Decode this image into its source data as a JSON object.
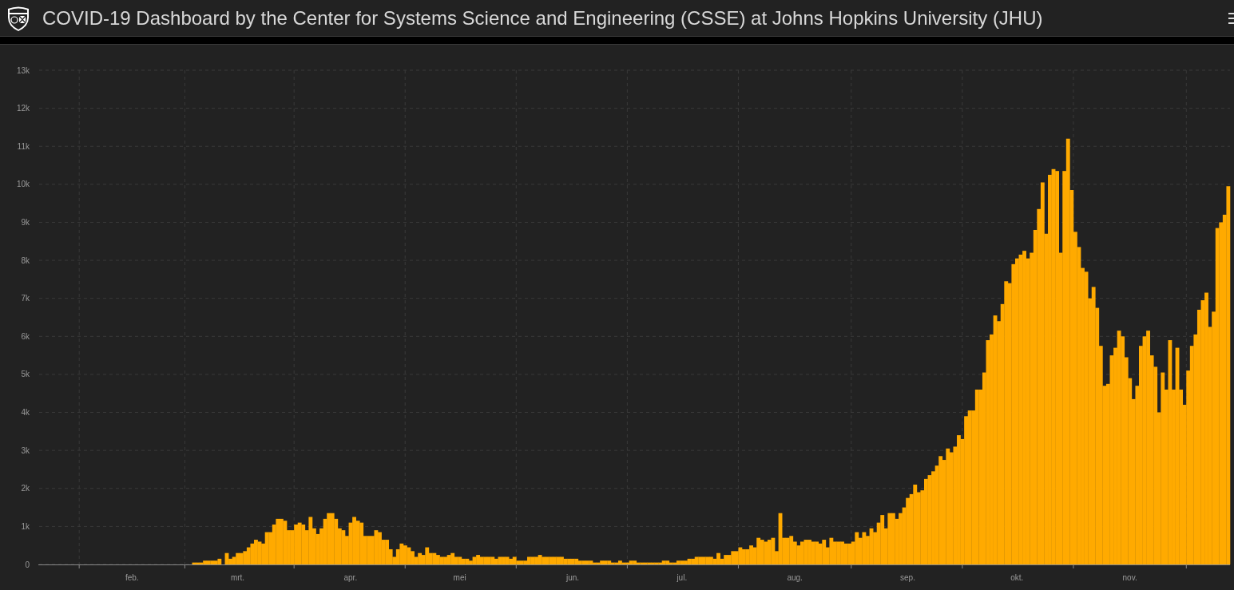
{
  "header": {
    "title": "COVID-19 Dashboard by the Center for Systems Science and Engineering (CSSE) at Johns Hopkins University (JHU)"
  },
  "chart": {
    "chart_data": {
      "type": "bar",
      "grid": true,
      "categories": [
        null,
        null,
        null,
        null,
        null,
        null,
        null,
        null,
        null,
        null,
        null,
        null,
        null,
        null,
        null,
        null,
        null,
        null,
        null,
        null,
        null,
        null,
        null,
        null,
        null,
        "feb.",
        null,
        null,
        null,
        null,
        null,
        null,
        null,
        null,
        null,
        null,
        null,
        null,
        null,
        null,
        null,
        null,
        null,
        null,
        null,
        null,
        null,
        null,
        null,
        null,
        null,
        null,
        null,
        null,
        "mrt.",
        null,
        null,
        null,
        null,
        null,
        null,
        null,
        null,
        null,
        null,
        null,
        null,
        null,
        null,
        null,
        null,
        null,
        null,
        null,
        null,
        null,
        null,
        null,
        null,
        null,
        null,
        null,
        null,
        null,
        null,
        "apr.",
        null,
        null,
        null,
        null,
        null,
        null,
        null,
        null,
        null,
        null,
        null,
        null,
        null,
        null,
        null,
        null,
        null,
        null,
        null,
        null,
        null,
        null,
        null,
        null,
        null,
        null,
        null,
        null,
        null,
        "mei",
        null,
        null,
        null,
        null,
        null,
        null,
        null,
        null,
        null,
        null,
        null,
        null,
        null,
        null,
        null,
        null,
        null,
        null,
        null,
        null,
        null,
        null,
        null,
        null,
        null,
        null,
        null,
        null,
        null,
        null,
        "jun.",
        null,
        null,
        null,
        null,
        null,
        null,
        null,
        null,
        null,
        null,
        null,
        null,
        null,
        null,
        null,
        null,
        null,
        null,
        null,
        null,
        null,
        null,
        null,
        null,
        null,
        null,
        null,
        null,
        null,
        "jul.",
        null,
        null,
        null,
        null,
        null,
        null,
        null,
        null,
        null,
        null,
        null,
        null,
        null,
        null,
        null,
        null,
        null,
        null,
        null,
        null,
        null,
        null,
        null,
        null,
        null,
        null,
        null,
        null,
        null,
        null,
        "aug.",
        null,
        null,
        null,
        null,
        null,
        null,
        null,
        null,
        null,
        null,
        null,
        null,
        null,
        null,
        null,
        null,
        null,
        null,
        null,
        null,
        null,
        null,
        null,
        null,
        null,
        null,
        null,
        null,
        null,
        null,
        "sep.",
        null,
        null,
        null,
        null,
        null,
        null,
        null,
        null,
        null,
        null,
        null,
        null,
        null,
        null,
        null,
        null,
        null,
        null,
        null,
        null,
        null,
        null,
        null,
        null,
        null,
        null,
        null,
        null,
        null,
        "okt.",
        null,
        null,
        null,
        null,
        null,
        null,
        null,
        null,
        null,
        null,
        null,
        null,
        null,
        null,
        null,
        null,
        null,
        null,
        null,
        null,
        null,
        null,
        null,
        null,
        null,
        null,
        null,
        null,
        null,
        null,
        "nov.",
        null,
        null,
        null,
        null,
        null,
        null,
        null,
        null,
        null,
        null,
        null,
        null,
        null,
        null,
        null,
        null,
        null,
        null,
        null,
        null,
        null,
        null,
        null,
        null,
        null,
        null,
        null
      ],
      "values": [
        0,
        0,
        0,
        0,
        0,
        0,
        0,
        0,
        0,
        0,
        0,
        0,
        0,
        0,
        0,
        0,
        0,
        0,
        0,
        0,
        0,
        0,
        0,
        0,
        0,
        0,
        0,
        0,
        0,
        0,
        0,
        0,
        0,
        0,
        0,
        0,
        0,
        0,
        0,
        0,
        0,
        0,
        50,
        50,
        50,
        100,
        100,
        100,
        100,
        150,
        0,
        300,
        150,
        200,
        300,
        300,
        350,
        450,
        550,
        650,
        600,
        550,
        850,
        850,
        1050,
        1200,
        1200,
        1150,
        900,
        900,
        1050,
        1100,
        1050,
        900,
        1250,
        950,
        800,
        950,
        1200,
        1350,
        1350,
        1200,
        950,
        900,
        750,
        1100,
        1250,
        1150,
        1100,
        750,
        750,
        750,
        900,
        850,
        650,
        650,
        400,
        200,
        400,
        550,
        500,
        450,
        350,
        200,
        300,
        250,
        450,
        300,
        300,
        250,
        200,
        200,
        250,
        300,
        200,
        200,
        150,
        150,
        100,
        200,
        250,
        200,
        200,
        200,
        200,
        150,
        200,
        200,
        200,
        150,
        200,
        100,
        100,
        100,
        200,
        200,
        200,
        250,
        200,
        200,
        200,
        200,
        200,
        200,
        150,
        150,
        150,
        150,
        100,
        100,
        100,
        100,
        50,
        50,
        100,
        100,
        100,
        50,
        50,
        100,
        50,
        50,
        100,
        100,
        50,
        50,
        50,
        50,
        50,
        50,
        50,
        100,
        100,
        50,
        50,
        100,
        100,
        100,
        150,
        150,
        200,
        200,
        200,
        200,
        200,
        150,
        300,
        150,
        250,
        250,
        350,
        350,
        450,
        400,
        400,
        500,
        450,
        700,
        650,
        600,
        650,
        700,
        350,
        1350,
        700,
        700,
        750,
        600,
        500,
        600,
        650,
        650,
        600,
        600,
        550,
        650,
        450,
        700,
        600,
        600,
        600,
        550,
        550,
        600,
        850,
        700,
        850,
        750,
        950,
        850,
        1100,
        1300,
        950,
        1350,
        1350,
        1200,
        1350,
        1500,
        1750,
        1850,
        2100,
        1900,
        1950,
        2250,
        2350,
        2450,
        2600,
        2850,
        2750,
        3050,
        2950,
        3100,
        3400,
        3300,
        3900,
        4050,
        4050,
        4600,
        4600,
        5050,
        5900,
        6050,
        6550,
        6400,
        6850,
        7450,
        7400,
        7900,
        8050,
        8150,
        8250,
        8050,
        8200,
        8800,
        9350,
        10050,
        8700,
        10250,
        10400,
        10350,
        8200,
        10350,
        11200,
        9850,
        8750,
        8350,
        7800,
        7700,
        7000,
        7300,
        6750,
        5750,
        4700,
        4750,
        5500,
        5700,
        6150,
        6000,
        5450,
        4900,
        4350,
        4700,
        5750,
        6000,
        6150,
        5500,
        5200,
        4000,
        5050,
        4600,
        5900,
        4600,
        5700,
        4600,
        4200,
        5100,
        5750,
        6050,
        6700,
        6950,
        7150,
        6250,
        6650,
        8850,
        9000,
        9200,
        9950
      ],
      "ylim": [
        0,
        13000
      ],
      "yticks": [
        {
          "value": 0,
          "label": "0"
        },
        {
          "value": 1000,
          "label": "1k"
        },
        {
          "value": 2000,
          "label": "2k"
        },
        {
          "value": 3000,
          "label": "3k"
        },
        {
          "value": 4000,
          "label": "4k"
        },
        {
          "value": 5000,
          "label": "5k"
        },
        {
          "value": 6000,
          "label": "6k"
        },
        {
          "value": 7000,
          "label": "7k"
        },
        {
          "value": 8000,
          "label": "8k"
        },
        {
          "value": 9000,
          "label": "9k"
        },
        {
          "value": 10000,
          "label": "10k"
        },
        {
          "value": 11000,
          "label": "11k"
        },
        {
          "value": 12000,
          "label": "12k"
        },
        {
          "value": 13000,
          "label": "13k"
        }
      ]
    }
  }
}
